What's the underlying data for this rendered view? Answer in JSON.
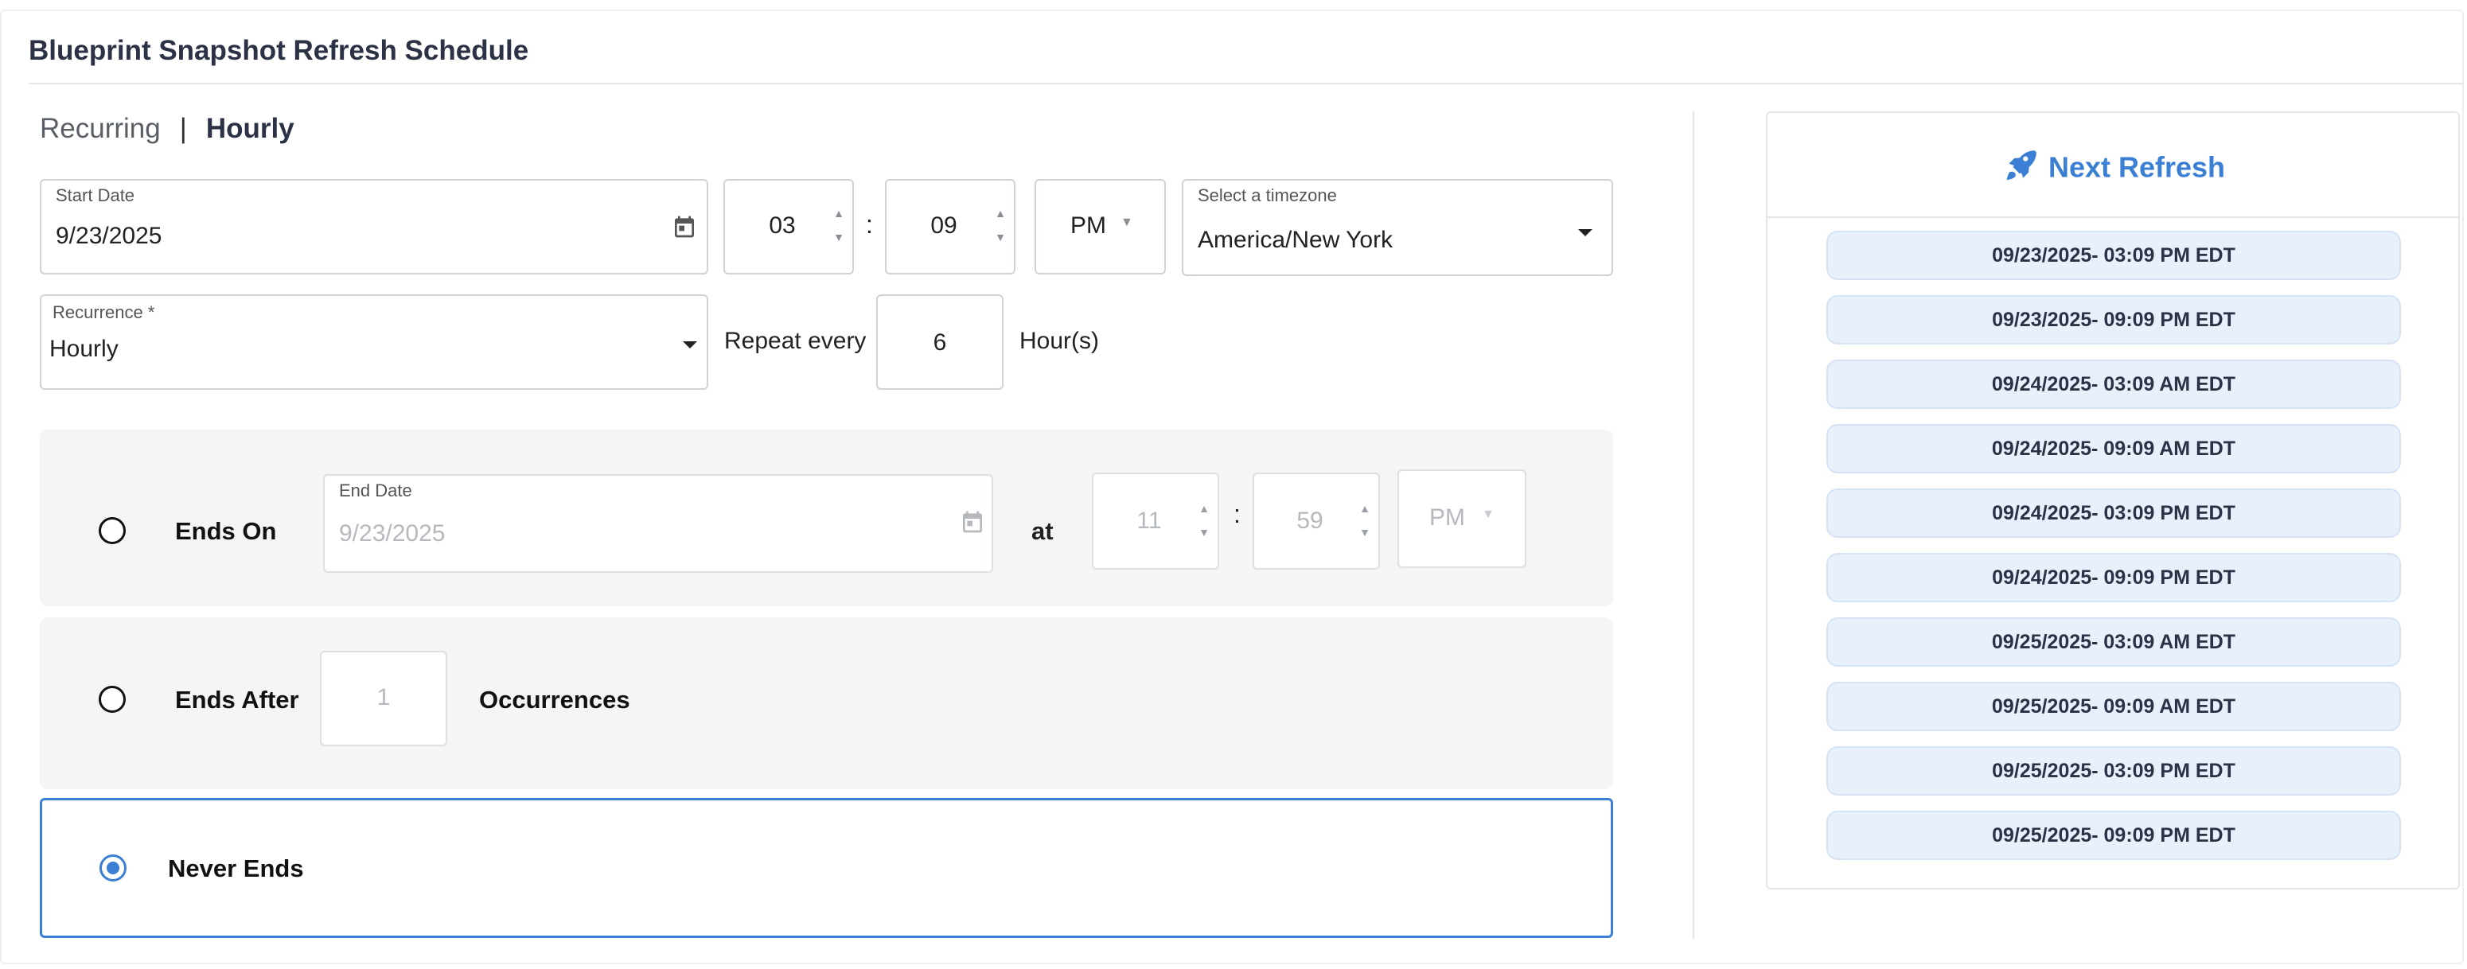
{
  "title": "Blueprint Snapshot Refresh Schedule",
  "tabs": {
    "recurring": "Recurring",
    "separator": "|",
    "hourly": "Hourly"
  },
  "start": {
    "date_label": "Start Date",
    "date_value": "9/23/2025",
    "hour": "03",
    "minute": "09",
    "ampm": "PM",
    "timezone_label": "Select a timezone",
    "timezone_value": "America/New York"
  },
  "recurrence": {
    "label": "Recurrence *",
    "value": "Hourly",
    "repeat_every_label": "Repeat every",
    "repeat_value": "6",
    "unit": "Hour(s)"
  },
  "end_options": {
    "ends_on": {
      "label": "Ends On",
      "date_label": "End Date",
      "date_value": "9/23/2025",
      "at_label": "at",
      "hour": "11",
      "minute": "59",
      "ampm": "PM"
    },
    "ends_after": {
      "label": "Ends After",
      "count": "1",
      "unit": "Occurrences"
    },
    "never_ends": {
      "label": "Never Ends",
      "selected": true
    }
  },
  "colon": ":",
  "next_refresh": {
    "title": "Next Refresh",
    "items": [
      "09/23/2025- 03:09 PM EDT",
      "09/23/2025- 09:09 PM EDT",
      "09/24/2025- 03:09 AM EDT",
      "09/24/2025- 09:09 AM EDT",
      "09/24/2025- 03:09 PM EDT",
      "09/24/2025- 09:09 PM EDT",
      "09/25/2025- 03:09 AM EDT",
      "09/25/2025- 09:09 AM EDT",
      "09/25/2025- 03:09 PM EDT",
      "09/25/2025- 09:09 PM EDT"
    ]
  },
  "colors": {
    "accent": "#3a7fd4",
    "panel": "#f5f5f5",
    "pill": "#e7f0fb"
  },
  "icons": {
    "calendar": "calendar-icon",
    "rocket": "rocket-icon"
  }
}
